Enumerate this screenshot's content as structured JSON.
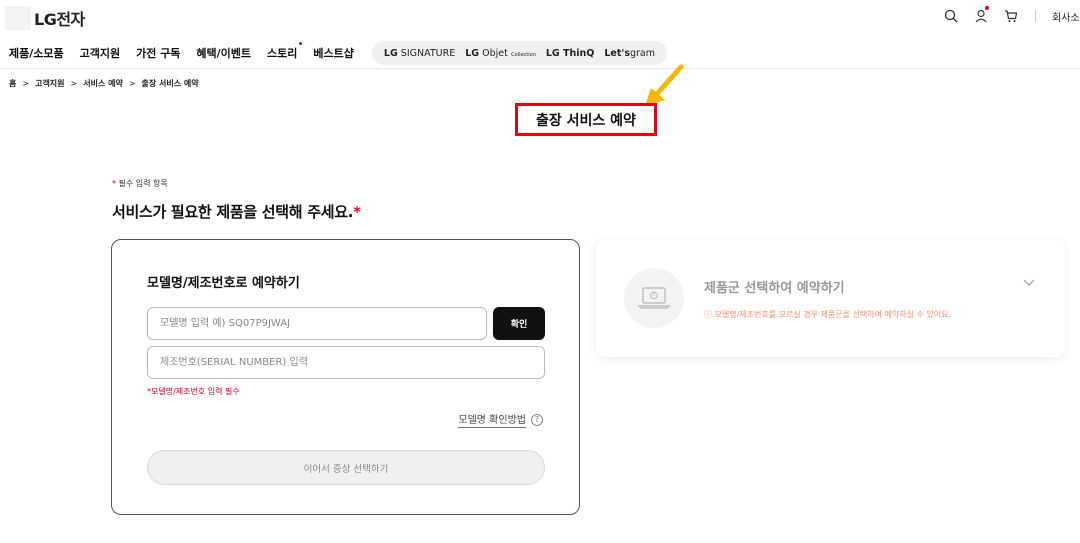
{
  "header": {
    "logo_text": "LG전자",
    "company_link": "회사소개",
    "gnb": [
      {
        "label": "제품/소모품",
        "dot": false
      },
      {
        "label": "고객지원",
        "dot": false
      },
      {
        "label": "가전 구독",
        "dot": false
      },
      {
        "label": "혜택/이벤트",
        "dot": false
      },
      {
        "label": "스토리",
        "dot": true
      },
      {
        "label": "베스트샵",
        "dot": false
      }
    ],
    "brands": {
      "signature_bold": "LG",
      "signature_rest": " SIGNATURE",
      "objet_bold": "LG",
      "objet_rest": " Objet",
      "objet_small": "Collection",
      "thinq": "LG ThinQ",
      "gram_bold": "Let's",
      "gram_rest": "gram"
    }
  },
  "breadcrumb": [
    "홈",
    "고객지원",
    "서비스 예약",
    "출장 서비스 예약"
  ],
  "page_title": "출장 서비스 예약",
  "form": {
    "required_note": "필수 입력 항목",
    "heading": "서비스가 필요한 제품을 선택해 주세요.",
    "star": "*"
  },
  "card_model": {
    "title": "모델명/제조번호로 예약하기",
    "model_placeholder": "모델명 입력 예) SQ07P9JWAJ",
    "confirm_label": "확인",
    "serial_placeholder": "제조번호(SERIAL NUMBER) 입력",
    "error": "*모델명/제조번호 입력 필수",
    "help_link": "모델명 확인방법",
    "help_icon": "?",
    "next_label": "이어서 증상 선택하기"
  },
  "card_category": {
    "title": "제품군 선택하여 예약하기",
    "desc": "ⓘ 모델명/제조번호를 모르실 경우 제품군을 선택하여 예약하실 수 있어요."
  },
  "colors": {
    "accent_red": "#e4002b",
    "highlight_box": "#e60012",
    "arrow": "#f5b800",
    "info_text": "#f19077"
  },
  "icons": [
    "search-icon",
    "user-icon",
    "cart-icon",
    "laptop-icon",
    "chevron-down-icon",
    "arrow-annotation-icon"
  ]
}
